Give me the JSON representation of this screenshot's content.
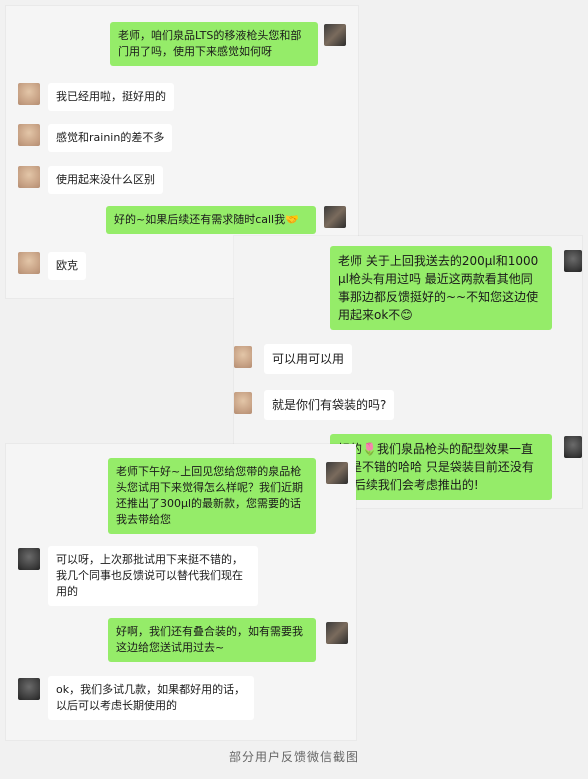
{
  "card1": {
    "messages": [
      {
        "side": "right",
        "text": "老师，咱们泉品LTS的移液枪头您和部门用了吗，使用下来感觉如何呀"
      },
      {
        "side": "left",
        "text": "我已经用啦，挺好用的"
      },
      {
        "side": "left",
        "text": "感觉和rainin的差不多"
      },
      {
        "side": "left",
        "text": "使用起来没什么区别"
      },
      {
        "side": "right",
        "text": "好的~如果后续还有需求随时call我🤝"
      },
      {
        "side": "left",
        "text": "欧克"
      }
    ]
  },
  "card2": {
    "messages": [
      {
        "side": "right",
        "text": "老师 关于上回我送去的200μl和1000μl枪头有用过吗 最近这两款看其他同事那边都反馈挺好的~~不知您这边使用起来ok不😊"
      },
      {
        "side": "left",
        "text": "可以用可以用"
      },
      {
        "side": "left",
        "text": "就是你们有袋装的吗?"
      },
      {
        "side": "right",
        "text": "好的🌷我们泉品枪头的配型效果一直都是不错的哈哈  只是袋装目前还没有哦 后续我们会考虑推出的!"
      }
    ]
  },
  "card3": {
    "messages": [
      {
        "side": "right",
        "text": "老师下午好~上回见您给您带的泉品枪头您试用下来觉得怎么样呢？我们近期还推出了300μl的最新款，您需要的话我去带给您"
      },
      {
        "side": "left",
        "text": "可以呀，上次那批试用下来挺不错的，我几个同事也反馈说可以替代我们现在用的"
      },
      {
        "side": "right",
        "text": "好啊，我们还有叠合装的，如有需要我这边给您送试用过去~"
      },
      {
        "side": "left",
        "text": "ok，我们多试几款，如果都好用的话，以后可以考虑长期使用的"
      }
    ]
  },
  "caption": "部分用户反馈微信截图"
}
